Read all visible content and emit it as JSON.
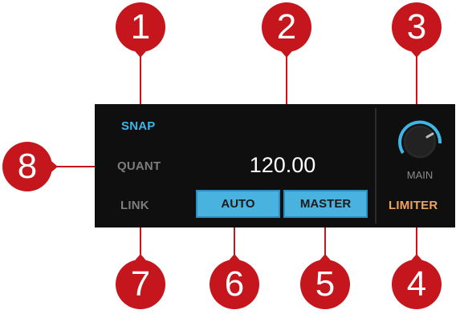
{
  "colors": {
    "panel_bg": "#0f0f0f",
    "accent_blue": "#3fb6e6",
    "button_blue": "#4ab2df",
    "limiter_orange": "#f0a35a",
    "callout_red": "#c4161c"
  },
  "labels": {
    "snap": "SNAP",
    "quant": "QUANT",
    "link": "LINK",
    "tempo": "120.00",
    "auto": "AUTO",
    "master": "MASTER",
    "main": "MAIN",
    "limiter": "LIMITER"
  },
  "callouts": [
    "1",
    "2",
    "3",
    "4",
    "5",
    "6",
    "7",
    "8"
  ]
}
